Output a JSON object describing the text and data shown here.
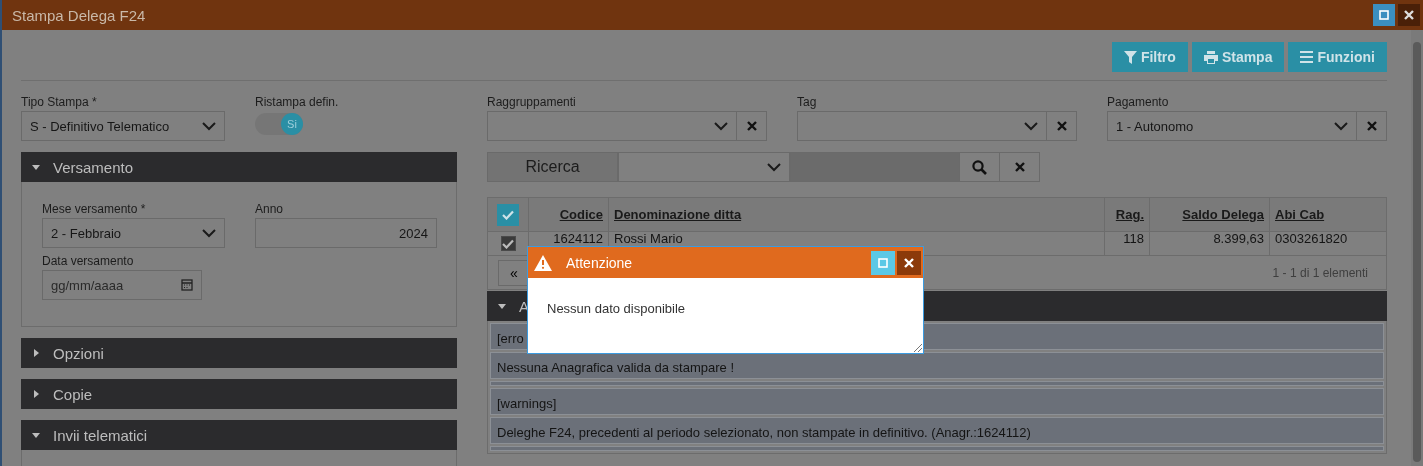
{
  "window": {
    "title": "Stampa Delega F24"
  },
  "toolbar": [
    {
      "label": "Filtro"
    },
    {
      "label": "Stampa"
    },
    {
      "label": "Funzioni"
    }
  ],
  "tipo_stampa": {
    "label": "Tipo Stampa *",
    "value": "S - Definitivo Telematico"
  },
  "ristampa": {
    "label": "Ristampa defin.",
    "on": true,
    "text": "Si"
  },
  "sections": [
    {
      "title": "Versamento",
      "expanded": true,
      "fields": [
        {
          "kind": "select",
          "label": "Mese versamento *",
          "value": "2 - Febbraio"
        },
        {
          "kind": "number",
          "label": "Anno",
          "value": "2024"
        },
        {
          "kind": "date",
          "label": "Data versamento",
          "placeholder": "gg/mm/aaaa"
        }
      ]
    },
    {
      "title": "Opzioni",
      "expanded": false
    },
    {
      "title": "Copie",
      "expanded": false
    },
    {
      "title": "Invii telematici",
      "expanded": true
    }
  ],
  "filters": [
    {
      "label": "Raggruppamenti"
    },
    {
      "label": "Tag"
    },
    {
      "label": "Pagamento",
      "value": "1 - Autonomo"
    }
  ],
  "search": {
    "label": "Ricerca"
  },
  "table": {
    "all_checked": true,
    "columns": [
      {
        "label": "Codice"
      },
      {
        "label": "Denominazione ditta"
      },
      {
        "label": "Rag."
      },
      {
        "label": "Saldo Delega"
      },
      {
        "label": "Abi Cab"
      }
    ],
    "rows": [
      {
        "checked": true,
        "cells": [
          "1624112",
          "Rossi Mario",
          "118",
          "8.399,63",
          "0303261820"
        ]
      }
    ]
  },
  "pager": {
    "first": "«",
    "info": "1 - 1 di 1 elementi"
  },
  "log": {
    "title": "A",
    "expanded": true,
    "messages": [
      {
        "kind": "text",
        "text": "[erro"
      },
      {
        "kind": "text",
        "text": "Nessuna Anagrafica valida da stampare !"
      },
      {
        "kind": "spacer"
      },
      {
        "kind": "text",
        "text": "[warnings]"
      },
      {
        "kind": "text",
        "text": "Deleghe F24, precedenti al periodo selezionato, non stampate in definitivo. (Anagr.:1624112)"
      },
      {
        "kind": "spacer"
      }
    ]
  },
  "dialog": {
    "title": "Attenzione",
    "message": "Nessun dato disponibile"
  }
}
